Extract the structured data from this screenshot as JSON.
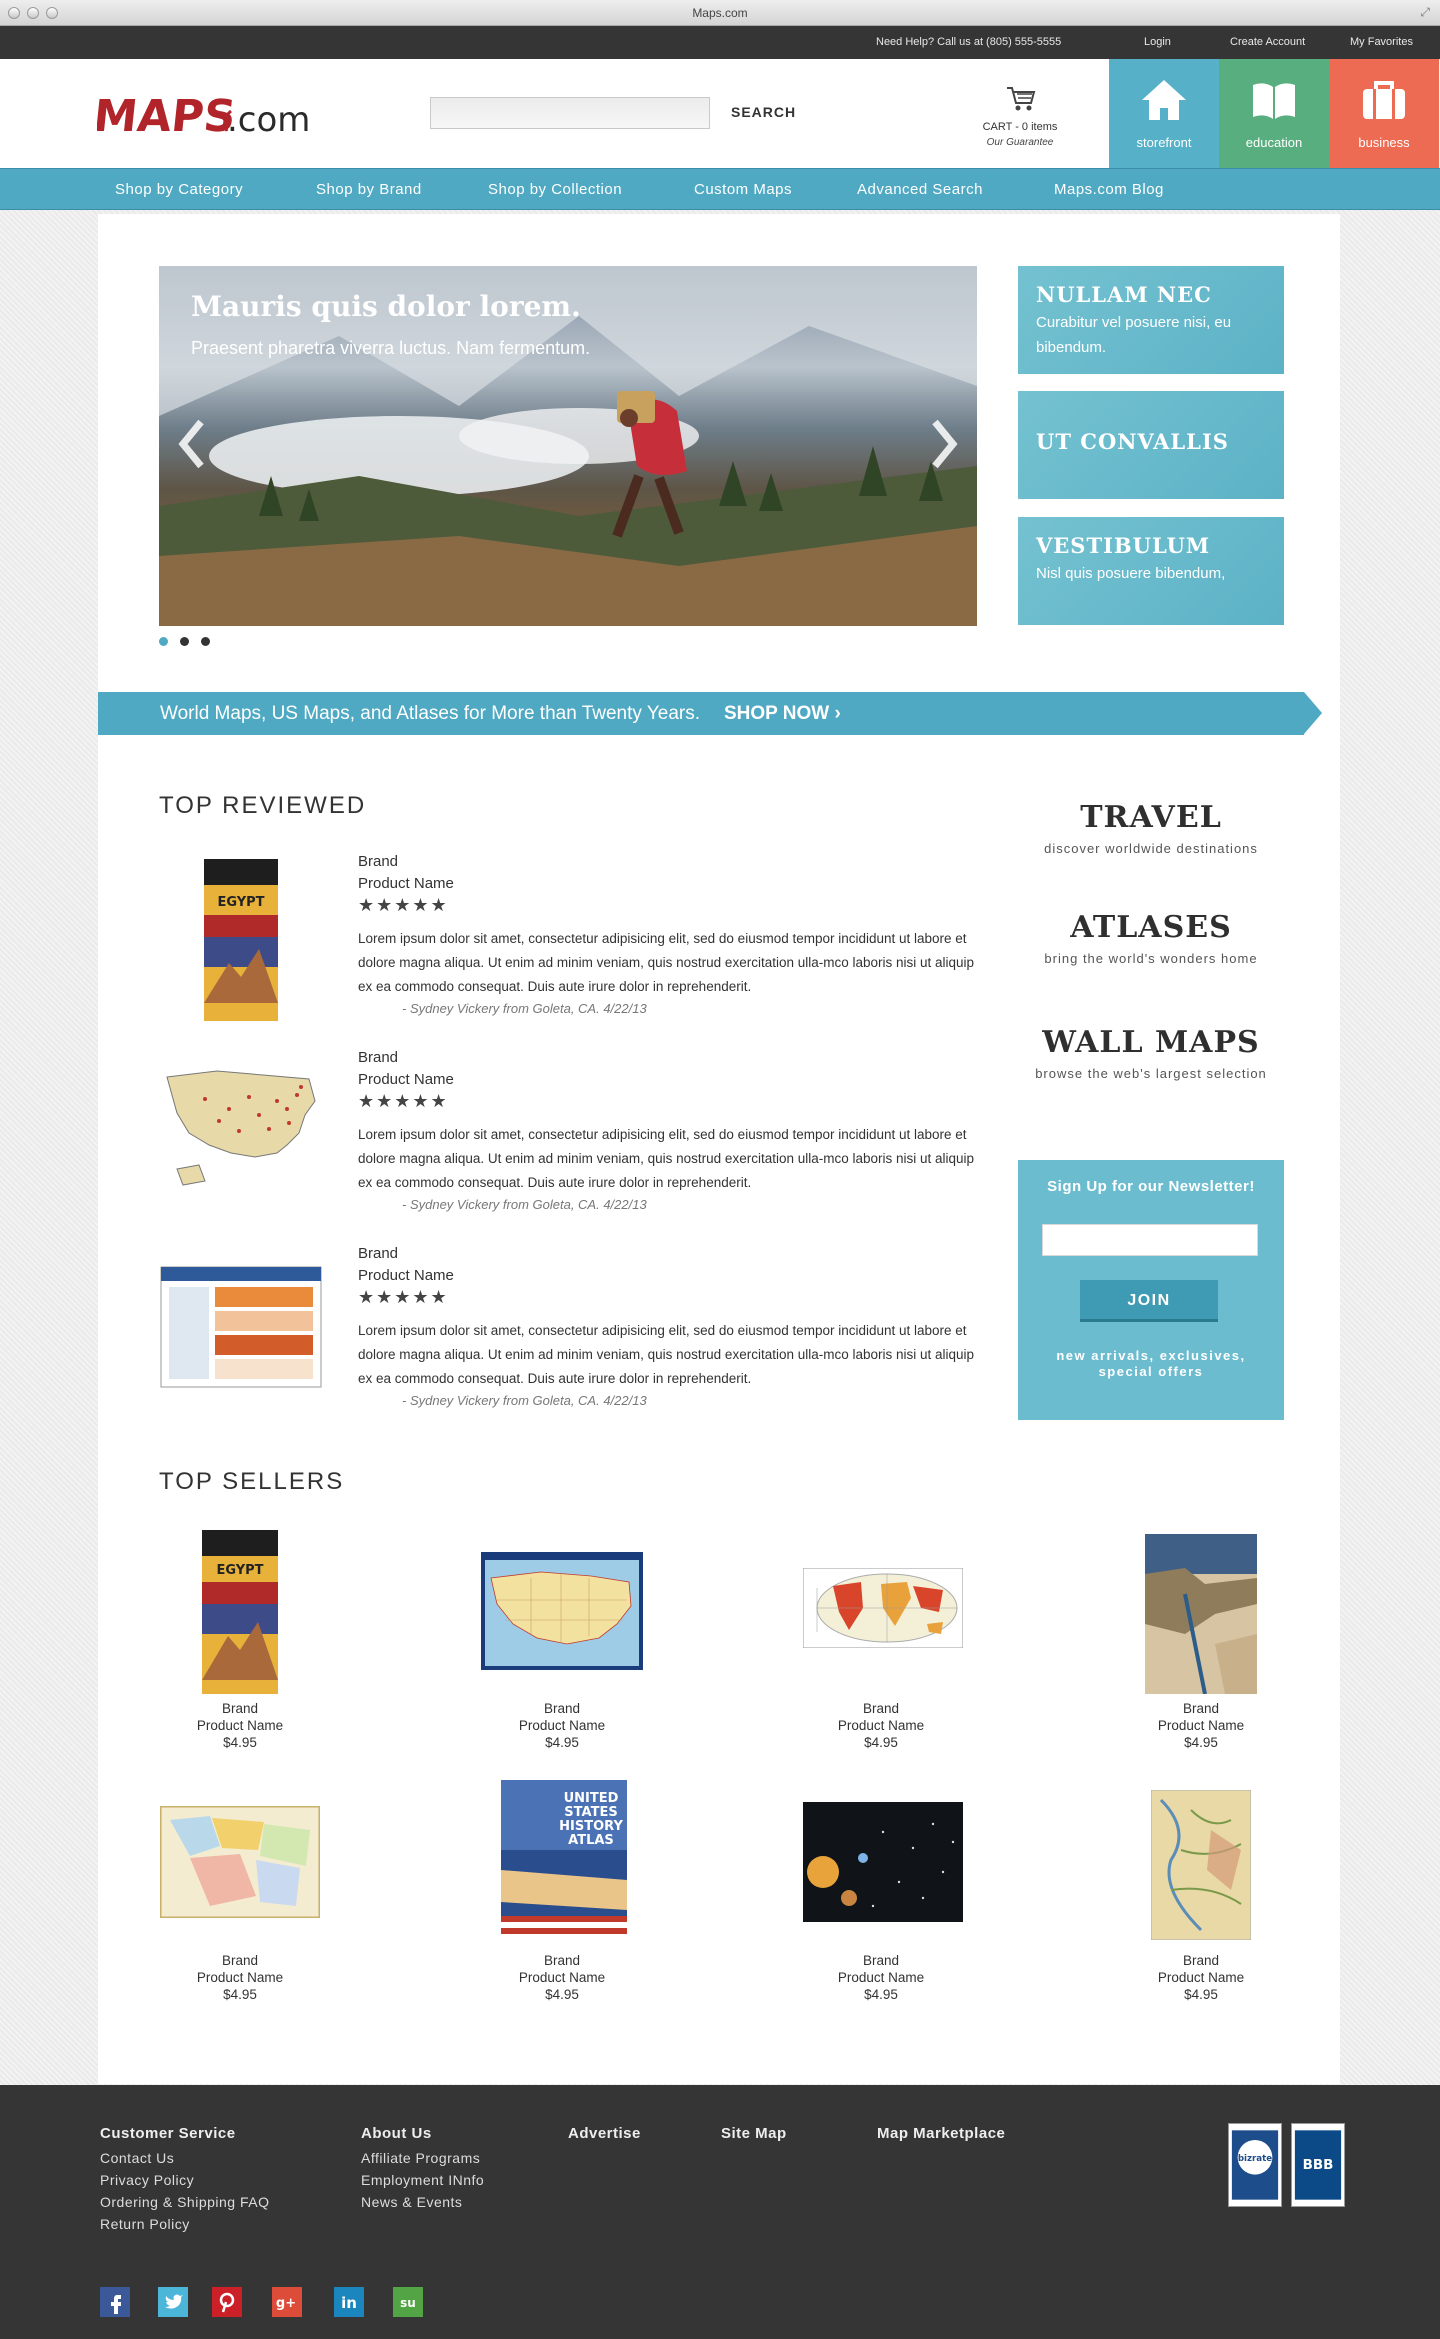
{
  "window": {
    "title": "Maps.com"
  },
  "utility": {
    "help": "Need Help? Call us at (805) 555-5555",
    "login": "Login",
    "create_account": "Create Account",
    "favorites": "My Favorites"
  },
  "header": {
    "logo_text": "MAPS",
    "logo_suffix": ".com",
    "search_button": "SEARCH",
    "cart": "CART - 0 items",
    "guarantee": "Our Guarantee",
    "tabs": [
      {
        "label": "storefront",
        "icon": "house-icon",
        "color": "#56b1c8"
      },
      {
        "label": "education",
        "icon": "book-icon",
        "color": "#58ae7e"
      },
      {
        "label": "business",
        "icon": "briefcase-icon",
        "color": "#ec6b52"
      }
    ]
  },
  "nav": {
    "items": [
      "Shop by Category",
      "Shop by Brand",
      "Shop by Collection",
      "Custom Maps",
      "Advanced Search",
      "Maps.com Blog"
    ]
  },
  "hero": {
    "title": "Mauris quis dolor lorem.",
    "subtitle": "Praesent pharetra viverra luctus. Nam fermentum.",
    "slides": 3,
    "active_slide": 1
  },
  "promos": [
    {
      "title": "NULLAM NEC",
      "text": "Curabitur vel posuere nisi, eu bibendum."
    },
    {
      "title": "UT CONVALLIS",
      "text": ""
    },
    {
      "title": "VESTIBULUM",
      "text": "Nisl quis posuere bibendum,"
    }
  ],
  "banner": {
    "text": "World Maps, US Maps, and Atlases for More than Twenty Years.",
    "cta": "SHOP NOW ›"
  },
  "top_reviewed": {
    "title": "TOP REVIEWED",
    "items": [
      {
        "thumb": "egypt-map",
        "brand": "Brand",
        "product": "Product Name",
        "stars": "★★★★★",
        "text": "Lorem ipsum dolor sit amet, consectetur adipisicing elit, sed do eiusmod tempor incididunt ut labore et dolore magna aliqua. Ut enim ad minim veniam, quis nostrud exercitation ulla-mco laboris nisi ut aliquip ex ea commodo consequat. Duis aute irure dolor in reprehenderit.",
        "attribution": "- Sydney Vickery from Goleta, CA. 4/22/13"
      },
      {
        "thumb": "us-map",
        "brand": "Brand",
        "product": "Product Name",
        "stars": "★★★★★",
        "text": "Lorem ipsum dolor sit amet, consectetur adipisicing elit, sed do eiusmod tempor incididunt ut labore et dolore magna aliqua. Ut enim ad minim veniam, quis nostrud exercitation ulla-mco laboris nisi ut aliquip ex ea commodo consequat. Duis aute irure dolor in reprehenderit.",
        "attribution": "- Sydney Vickery from Goleta, CA. 4/22/13"
      },
      {
        "thumb": "chart-map",
        "brand": "Brand",
        "product": "Product Name",
        "stars": "★★★★★",
        "text": "Lorem ipsum dolor sit amet, consectetur adipisicing elit, sed do eiusmod tempor incididunt ut labore et dolore magna aliqua. Ut enim ad minim veniam, quis nostrud exercitation ulla-mco laboris nisi ut aliquip ex ea commodo consequat. Duis aute irure dolor in reprehenderit.",
        "attribution": "- Sydney Vickery from Goleta, CA. 4/22/13"
      }
    ]
  },
  "categories": [
    {
      "title": "TRAVEL",
      "sub": "discover worldwide destinations"
    },
    {
      "title": "ATLASES",
      "sub": "bring the world's wonders home"
    },
    {
      "title": "WALL MAPS",
      "sub": "browse the web's largest selection"
    }
  ],
  "newsletter": {
    "title": "Sign Up for our Newsletter!",
    "button": "JOIN",
    "sub": "new arrivals, exclusives, special offers"
  },
  "top_sellers": {
    "title": "TOP SELLERS",
    "items": [
      {
        "brand": "Brand",
        "product": "Product Name",
        "price": "$4.95"
      },
      {
        "brand": "Brand",
        "product": "Product Name",
        "price": "$4.95"
      },
      {
        "brand": "Brand",
        "product": "Product Name",
        "price": "$4.95"
      },
      {
        "brand": "Brand",
        "product": "Product Name",
        "price": "$4.95"
      },
      {
        "brand": "Brand",
        "product": "Product Name",
        "price": "$4.95"
      },
      {
        "brand": "Brand",
        "product": "Product Name",
        "price": "$4.95"
      },
      {
        "brand": "Brand",
        "product": "Product Name",
        "price": "$4.95"
      },
      {
        "brand": "Brand",
        "product": "Product Name",
        "price": "$4.95"
      }
    ],
    "atlas_cover": "UNITED STATES HISTORY ATLAS"
  },
  "footer": {
    "customer_service": {
      "title": "Customer Service",
      "links": [
        "Contact Us",
        "Privacy Policy",
        "Ordering & Shipping FAQ",
        "Return Policy"
      ]
    },
    "about": {
      "title": "About Us",
      "links": [
        "Affiliate Programs",
        "Employment INnfo",
        "News & Events"
      ]
    },
    "advertise": "Advertise",
    "site_map": "Site Map",
    "marketplace": "Map Marketplace",
    "social": [
      "facebook-icon",
      "twitter-icon",
      "pinterest-icon",
      "googleplus-icon",
      "linkedin-icon",
      "stumbleupon-icon"
    ],
    "badges": [
      "bizrate-badge",
      "bbb-badge"
    ]
  }
}
